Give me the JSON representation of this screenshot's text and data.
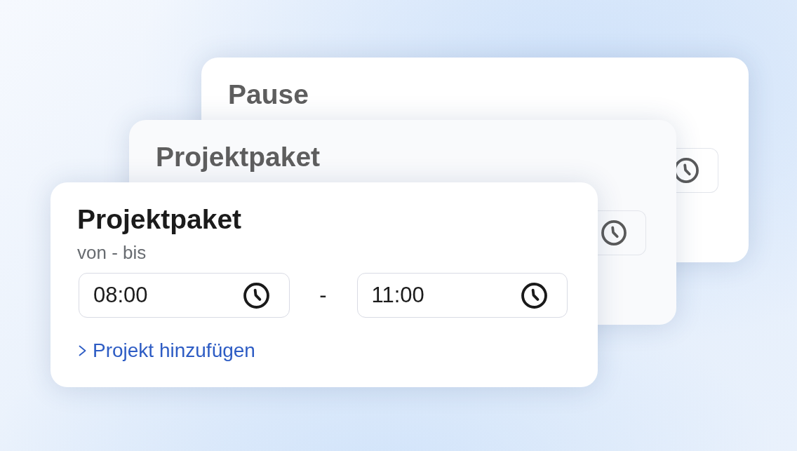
{
  "cards": [
    {
      "kind": "back",
      "title": "Pause"
    },
    {
      "kind": "back",
      "title": "Projektpaket"
    },
    {
      "kind": "front",
      "title": "Projektpaket",
      "label": "von - bis",
      "fields": [
        {
          "value": "08:00"
        },
        {
          "value": "11:00"
        }
      ],
      "separator": "-",
      "link": "Projekt hinzufügen"
    }
  ]
}
